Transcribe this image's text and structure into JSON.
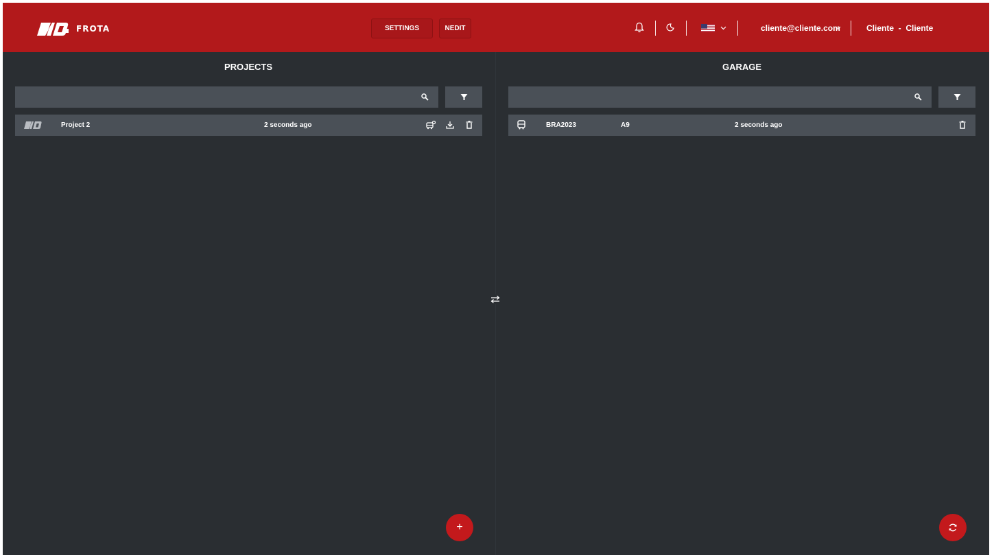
{
  "header": {
    "logo_text": "FROTA",
    "settings_label": "SETTINGS",
    "nedit_label": "NEDIT",
    "user_email": "cliente@cliente.com",
    "user_name": "Cliente  -  Cliente",
    "language_flag": "us-flag-icon"
  },
  "projects": {
    "title": "PROJECTS",
    "search_placeholder": "",
    "rows": [
      {
        "name": "Project 2",
        "time": "2 seconds ago"
      }
    ],
    "add_label": "+"
  },
  "garage": {
    "title": "GARAGE",
    "search_placeholder": "",
    "rows": [
      {
        "plate": "BRA2023",
        "model": "A9",
        "time": "2 seconds ago"
      }
    ]
  },
  "colors": {
    "header_bg": "#b2191b",
    "app_bg": "#2a2e32",
    "bar_bg": "#4a5057",
    "accent": "#c3191c"
  }
}
